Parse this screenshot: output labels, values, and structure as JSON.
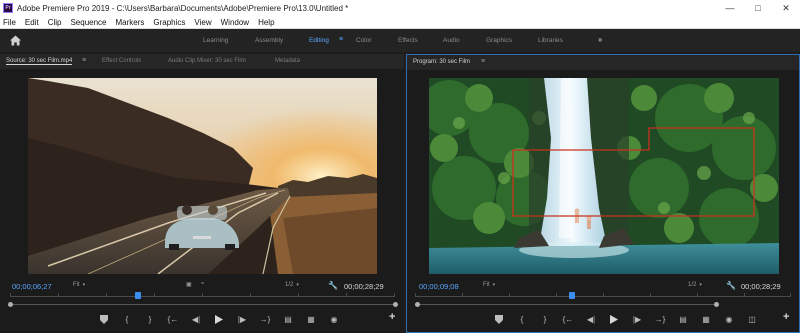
{
  "app": {
    "title": "Adobe Premiere Pro 2019 - C:\\Users\\Barbara\\Documents\\Adobe\\Premiere Pro\\13.0\\Untitled *",
    "icon_text": "Pr"
  },
  "menu": [
    "File",
    "Edit",
    "Clip",
    "Sequence",
    "Markers",
    "Graphics",
    "View",
    "Window",
    "Help"
  ],
  "workspaces": {
    "items": [
      "Learning",
      "Assembly",
      "Editing",
      "Color",
      "Effects",
      "Audio",
      "Graphics",
      "Libraries"
    ],
    "active": "Editing"
  },
  "source_panel": {
    "tabs": [
      "Source: 30 sec Film.mp4",
      "Effect Controls",
      "Audio Clip Mixer: 30 sec Film",
      "Metadata"
    ],
    "current_timecode": "00;00;06;27",
    "duration": "00;00;28;29",
    "fit": "Fit",
    "resolution": "1/2"
  },
  "program_panel": {
    "tab": "Program: 30 sec Film",
    "current_timecode": "00;00;09;08",
    "duration": "00;00;28;29",
    "fit": "Fit",
    "resolution": "1/2"
  },
  "colors": {
    "accent": "#3b8ef0",
    "timecode": "#5aa6ff",
    "panel_focus": "#2d6fb0",
    "overlay_box": "#c8321e"
  },
  "icons": [
    "home-icon",
    "workspace-menu-icon",
    "more-workspaces-icon",
    "wrench-icon",
    "add-marker-icon",
    "mark-in-icon",
    "mark-out-icon",
    "go-to-in-icon",
    "step-back-icon",
    "play-icon",
    "step-forward-icon",
    "go-to-out-icon",
    "insert-icon",
    "overwrite-icon",
    "export-frame-icon",
    "lift-icon",
    "extract-icon",
    "button-editor-icon"
  ]
}
